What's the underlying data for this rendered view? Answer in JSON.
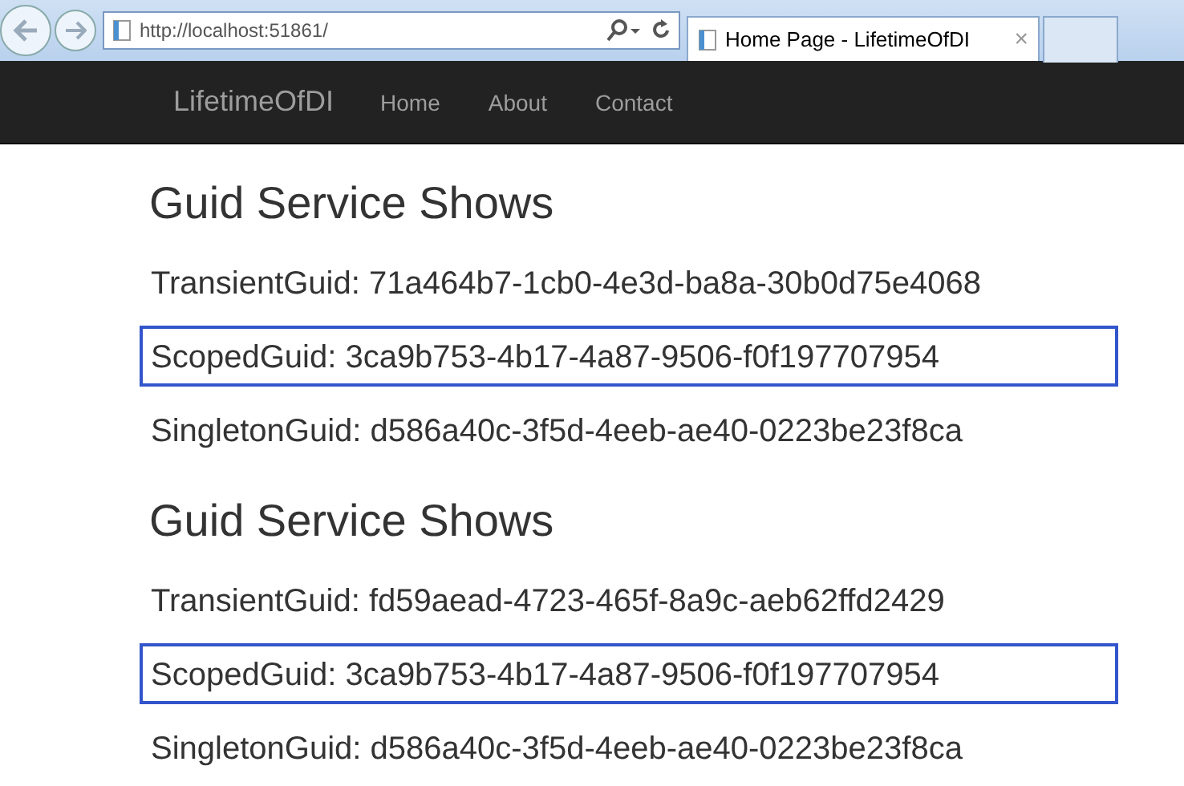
{
  "browser": {
    "address": "http://localhost:51861/",
    "tab": {
      "title": "Home Page - LifetimeOfDI",
      "close": "×",
      "selected": true
    }
  },
  "navbar": {
    "brand": "LifetimeOfDI",
    "links": [
      {
        "label": "Home"
      },
      {
        "label": "About"
      },
      {
        "label": "Contact"
      }
    ]
  },
  "sections": [
    {
      "heading": "Guid Service Shows",
      "lines": [
        {
          "text": "TransientGuid: 71a464b7-1cb0-4e3d-ba8a-30b0d75e4068",
          "highlighted": false
        },
        {
          "text": "ScopedGuid: 3ca9b753-4b17-4a87-9506-f0f197707954",
          "highlighted": true
        },
        {
          "text": "SingletonGuid: d586a40c-3f5d-4eeb-ae40-0223be23f8ca",
          "highlighted": false
        }
      ]
    },
    {
      "heading": "Guid Service Shows",
      "lines": [
        {
          "text": "TransientGuid: fd59aead-4723-465f-8a9c-aeb62ffd2429",
          "highlighted": false
        },
        {
          "text": "ScopedGuid: 3ca9b753-4b17-4a87-9506-f0f197707954",
          "highlighted": true
        },
        {
          "text": "SingletonGuid: d586a40c-3f5d-4eeb-ae40-0223be23f8ca",
          "highlighted": false
        }
      ]
    }
  ]
}
